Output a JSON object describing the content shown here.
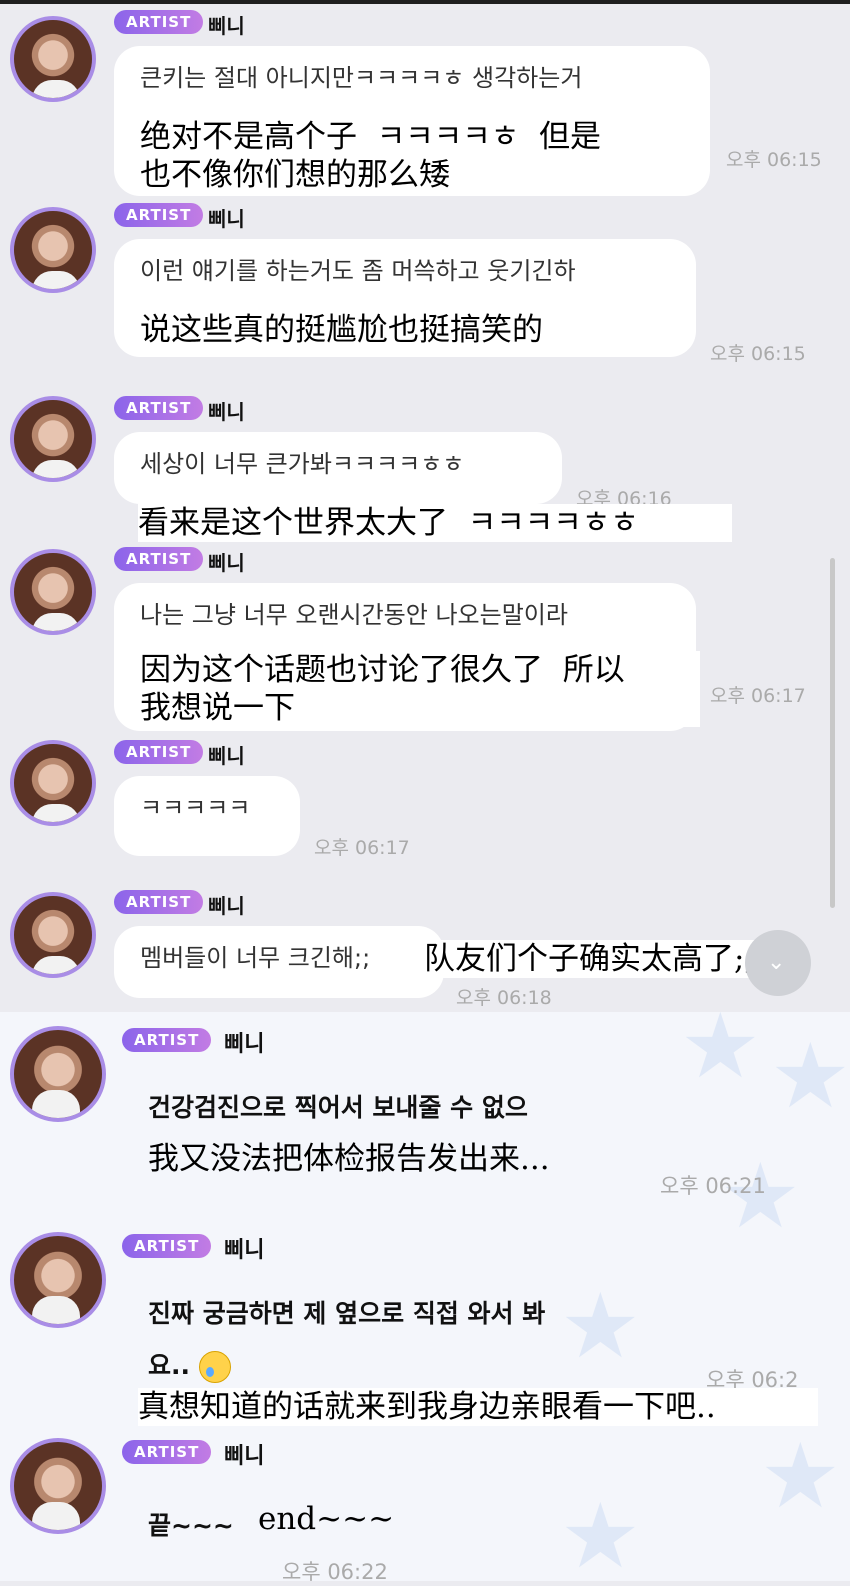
{
  "author": {
    "badge": "ARTIST",
    "name": "삐니"
  },
  "messages": [
    {
      "text": "큰키는 절대 아니지만ㅋㅋㅋㅋㅎ 생각하는거",
      "cn": "绝对不是高个子  ㅋㅋㅋㅋㅎ  但是\n也不像你们想的那么矮",
      "time": "오후 06:15"
    },
    {
      "text": "이런 얘기를 하는거도 좀 머쓱하고 웃기긴하",
      "cn": "说这些真的挺尴尬也挺搞笑的",
      "time": "오후 06:15"
    },
    {
      "text": "세상이 너무 큰가봐ㅋㅋㅋㅋㅎㅎ",
      "cn": "看来是这个世界太大了  ㅋㅋㅋㅋㅎㅎ",
      "time": "오후 06:16"
    },
    {
      "text": "나는 그냥 너무 오랜시간동안 나오는말이라",
      "cn": "因为这个话题也讨论了很久了  所以\n我想说一下",
      "time": "오후 06:17"
    },
    {
      "text": "ㅋㅋㅋㅋㅋ",
      "cn": "",
      "time": "오후 06:17"
    },
    {
      "text": "멤버들이 너무 크긴해;;",
      "cn": "队友们个子确实太高了;;",
      "time": "오후 06:18"
    },
    {
      "text": "건강검진으로 찍어서 보내줄 수 없으",
      "cn": "我又没法把体检报告发出来...",
      "time": "오후 06:21"
    },
    {
      "text": "진짜 궁금하면 제 옆으로 직접 와서 봐",
      "text2": "요..",
      "cn": "真想知道的话就来到我身边亲眼看一下吧..",
      "time": "오후 06:2"
    },
    {
      "text": "끝~~~",
      "cn": "end~~~",
      "time": "오후 06:22"
    }
  ]
}
